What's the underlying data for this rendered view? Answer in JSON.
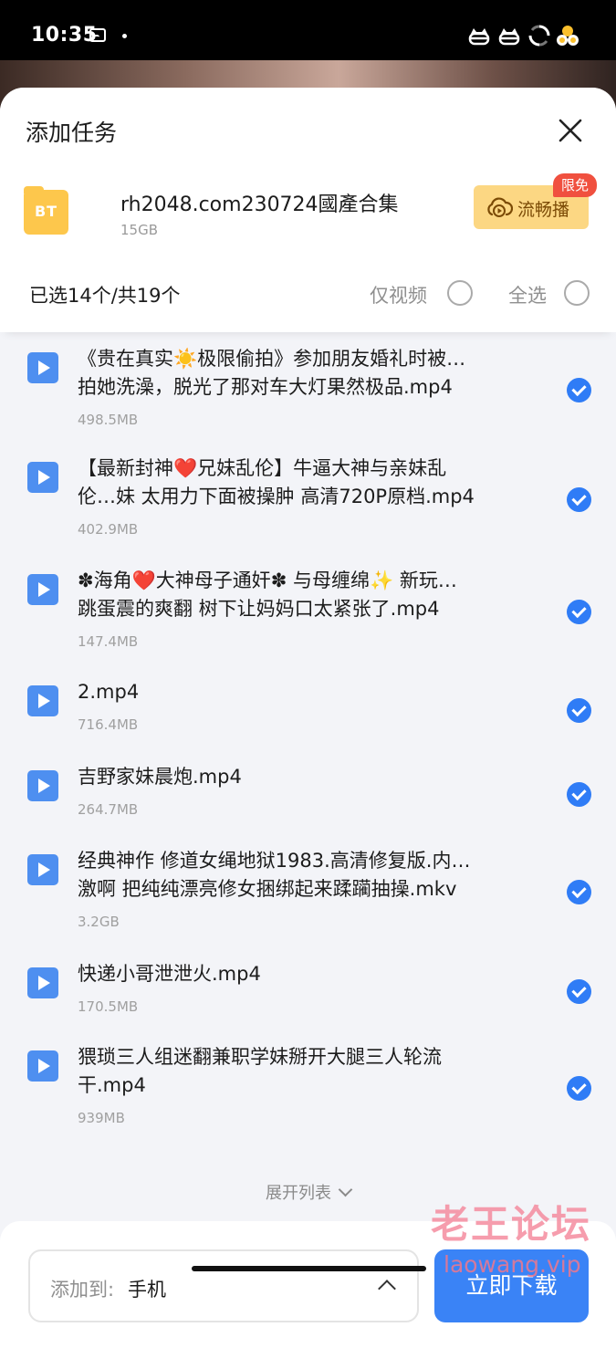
{
  "status_bar": {
    "time": "10:35"
  },
  "sheet": {
    "title": "添加任务",
    "torrent": {
      "icon_text": "BT",
      "name": "rh2048.com230724國產合集",
      "size": "15GB",
      "stream_button": "流畅播",
      "limit_badge": "限免"
    },
    "selection": {
      "count_text": "已选14个/共19个",
      "video_only_label": "仅视频",
      "select_all_label": "全选"
    },
    "files": [
      {
        "name": "《贵在真实☀️极限偷拍》参加朋友婚礼时被…\n拍她洗澡，脱光了那对车大灯果然极品.mp4",
        "size": "498.5MB"
      },
      {
        "name": "【最新封神❤️兄妹乱伦】牛逼大神与亲妹乱\n伦…妹 太用力下面被操肿 高清720P原档.mp4",
        "size": "402.9MB"
      },
      {
        "name": "✽海角❤️大神母子通奸✽ 与母缠绵✨ 新玩…\n跳蛋震的爽翻 树下让妈妈口太紧张了.mp4",
        "size": "147.4MB"
      },
      {
        "name": "2.mp4",
        "size": "716.4MB"
      },
      {
        "name": "吉野家妹晨炮.mp4",
        "size": "264.7MB"
      },
      {
        "name": "经典神作 修道女绳地狱1983.高清修复版.内…\n激啊 把纯纯漂亮修女捆绑起来蹂躏抽操.mkv",
        "size": "3.2GB"
      },
      {
        "name": "快递小哥泄泄火.mp4",
        "size": "170.5MB"
      },
      {
        "name": "猥琐三人组迷翻兼职学妹掰开大腿三人轮流\n干.mp4",
        "size": "939MB"
      }
    ],
    "expand_label": "展开列表",
    "destination": {
      "prefix": "添加到:",
      "value": "手机"
    },
    "download_button": "立即下载"
  },
  "watermark": {
    "line1": "老王论坛",
    "line2": "laowang.vip"
  },
  "colors": {
    "accent": "#3a83f6",
    "check": "#2f7cf6",
    "bt_icon": "#fdc74c",
    "stream_bg": "#fcd783",
    "badge": "#f0503f"
  }
}
